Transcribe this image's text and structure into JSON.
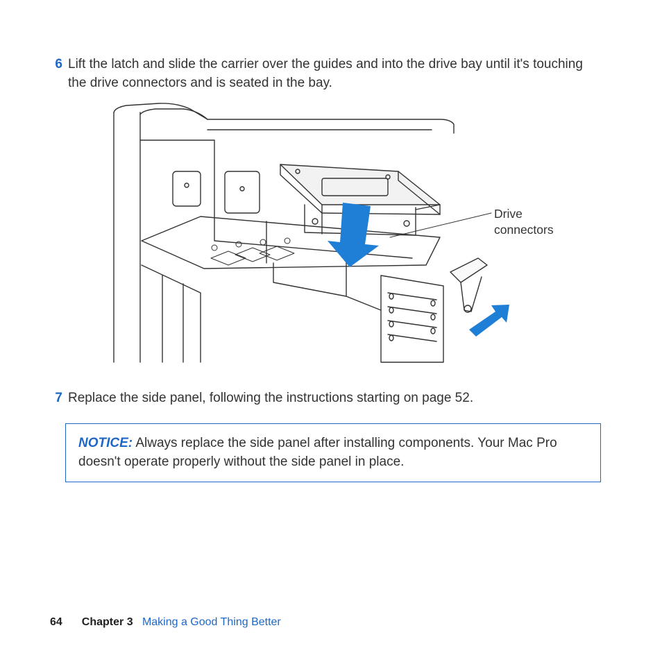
{
  "steps": [
    {
      "num": "6",
      "text": "Lift the latch and slide the carrier over the guides and into the drive bay until it's touching the drive connectors and is seated in the bay."
    },
    {
      "num": "7",
      "text": "Replace the side panel, following the instructions starting on page 52."
    }
  ],
  "callout": {
    "line1": "Drive",
    "line2": "connectors"
  },
  "notice": {
    "label": "NOTICE:",
    "text": "Always replace the side panel after installing components. Your Mac Pro doesn't operate properly without the side panel in place."
  },
  "footer": {
    "page": "64",
    "chapter_label": "Chapter 3",
    "chapter_title": "Making a Good Thing Better"
  }
}
